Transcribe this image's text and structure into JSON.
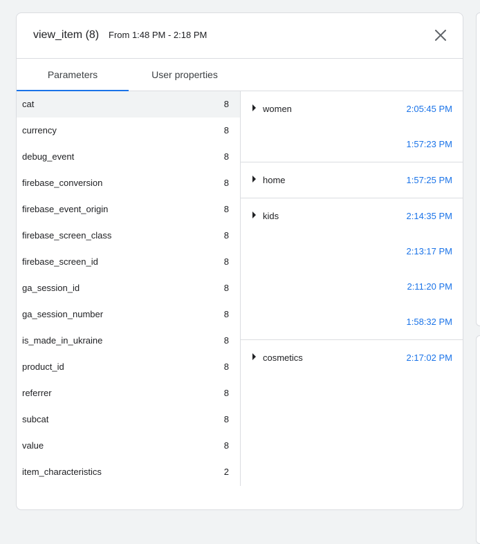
{
  "dialog": {
    "title": "view_item (8)",
    "subtitle": "From 1:48 PM - 2:18 PM",
    "close_icon": "close-icon"
  },
  "tabs": [
    {
      "label": "Parameters",
      "active": true
    },
    {
      "label": "User properties",
      "active": false
    }
  ],
  "colors": {
    "accent": "#1a73e8",
    "selected_bg": "#f1f3f4",
    "border": "#dadce0"
  },
  "parameters": [
    {
      "name": "cat",
      "count": "8"
    },
    {
      "name": "currency",
      "count": "8"
    },
    {
      "name": "debug_event",
      "count": "8"
    },
    {
      "name": "firebase_conversion",
      "count": "8"
    },
    {
      "name": "firebase_event_origin",
      "count": "8"
    },
    {
      "name": "firebase_screen_class",
      "count": "8"
    },
    {
      "name": "firebase_screen_id",
      "count": "8"
    },
    {
      "name": "ga_session_id",
      "count": "8"
    },
    {
      "name": "ga_session_number",
      "count": "8"
    },
    {
      "name": "is_made_in_ukraine",
      "count": "8"
    },
    {
      "name": "product_id",
      "count": "8"
    },
    {
      "name": "referrer",
      "count": "8"
    },
    {
      "name": "subcat",
      "count": "8"
    },
    {
      "name": "value",
      "count": "8"
    },
    {
      "name": "item_characteristics",
      "count": "2"
    }
  ],
  "value_groups": [
    {
      "label": "women",
      "times": [
        "2:05:45 PM",
        "1:57:23 PM"
      ]
    },
    {
      "label": "home",
      "times": [
        "1:57:25 PM"
      ]
    },
    {
      "label": "kids",
      "times": [
        "2:14:35 PM",
        "2:13:17 PM",
        "2:11:20 PM",
        "1:58:32 PM"
      ]
    },
    {
      "label": "cosmetics",
      "times": [
        "2:17:02 PM"
      ]
    }
  ]
}
